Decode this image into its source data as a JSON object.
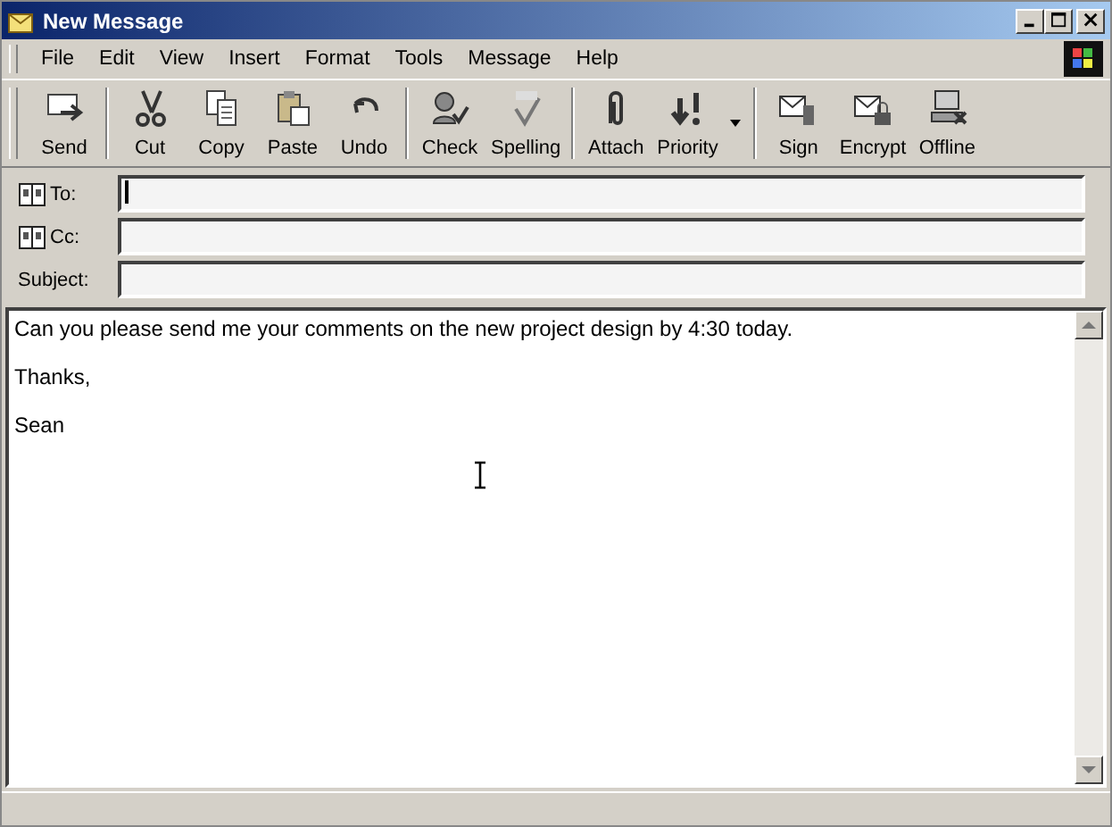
{
  "window": {
    "title": "New Message"
  },
  "menu": [
    "File",
    "Edit",
    "View",
    "Insert",
    "Format",
    "Tools",
    "Message",
    "Help"
  ],
  "toolbar": [
    {
      "buttons": [
        {
          "label": "Send",
          "dropdown": false
        }
      ]
    },
    {
      "buttons": [
        {
          "label": "Cut",
          "dropdown": false
        },
        {
          "label": "Copy",
          "dropdown": false
        },
        {
          "label": "Paste",
          "dropdown": false
        },
        {
          "label": "Undo",
          "dropdown": false
        }
      ]
    },
    {
      "buttons": [
        {
          "label": "Check",
          "dropdown": false
        },
        {
          "label": "Spelling",
          "dropdown": false
        }
      ]
    },
    {
      "buttons": [
        {
          "label": "Attach",
          "dropdown": false
        },
        {
          "label": "Priority",
          "dropdown": true
        }
      ]
    },
    {
      "buttons": [
        {
          "label": "Sign",
          "dropdown": false
        },
        {
          "label": "Encrypt",
          "dropdown": false
        },
        {
          "label": "Offline",
          "dropdown": false
        }
      ]
    }
  ],
  "header_fields": [
    {
      "label": "To:",
      "kind": "address",
      "focused": true
    },
    {
      "label": "Cc:",
      "kind": "address",
      "focused": false
    },
    {
      "label": "Subject:",
      "kind": "plain",
      "focused": false
    }
  ],
  "body": [
    "Can you please send me your comments on the new project design by 4:30 today.",
    "Thanks,",
    "Sean"
  ]
}
